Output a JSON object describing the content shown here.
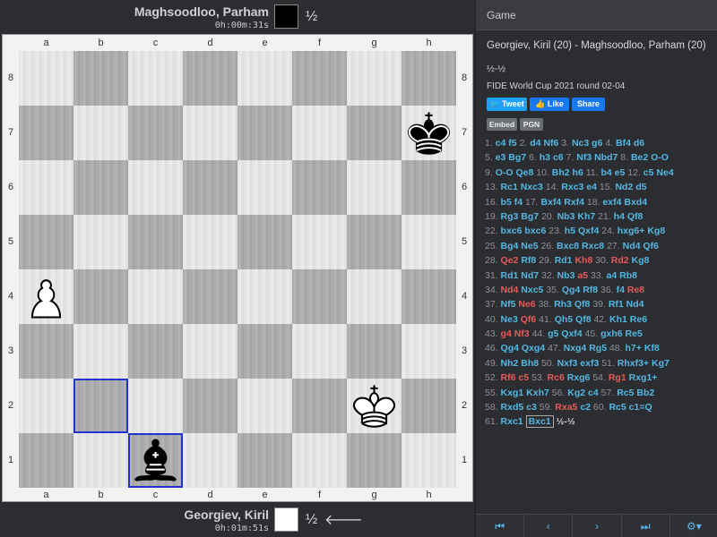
{
  "top_player": {
    "name": "Maghsoodloo, Parham",
    "clock": "0h:00m:31s",
    "result": "½"
  },
  "bottom_player": {
    "name": "Georgiev, Kiril",
    "clock": "0h:01m:51s",
    "result": "½",
    "to_move_arrow": "🡐"
  },
  "board": {
    "files": [
      "a",
      "b",
      "c",
      "d",
      "e",
      "f",
      "g",
      "h"
    ],
    "ranks": [
      "8",
      "7",
      "6",
      "5",
      "4",
      "3",
      "2",
      "1"
    ],
    "highlighted_squares": [
      "b2",
      "c1"
    ],
    "pieces": [
      {
        "square": "h7",
        "piece": "black-king"
      },
      {
        "square": "a4",
        "piece": "white-pawn"
      },
      {
        "square": "g2",
        "piece": "white-king"
      },
      {
        "square": "c1",
        "piece": "black-bishop"
      }
    ]
  },
  "panel": {
    "header": "Game",
    "title": "Georgiev, Kiril (20) - Maghsoodloo, Parham (20)",
    "result": "½-½",
    "event": "FIDE World Cup 2021 round 02-04",
    "tweet": "Tweet",
    "like": "Like",
    "share": "Share",
    "embed": "Embed",
    "pgn": "PGN"
  },
  "moves": [
    [
      [
        "n",
        "1."
      ],
      [
        "m",
        "c4"
      ],
      [
        "m",
        "f5"
      ],
      [
        "n",
        "2."
      ],
      [
        "m",
        "d4"
      ],
      [
        "m",
        "Nf6"
      ],
      [
        "n",
        "3."
      ],
      [
        "m",
        "Nc3"
      ],
      [
        "m",
        "g6"
      ],
      [
        "n",
        "4."
      ],
      [
        "m",
        "Bf4"
      ],
      [
        "m",
        "d6"
      ]
    ],
    [
      [
        "n",
        "5."
      ],
      [
        "m",
        "e3"
      ],
      [
        "m",
        "Bg7"
      ],
      [
        "n",
        "6."
      ],
      [
        "m",
        "h3"
      ],
      [
        "m",
        "c6"
      ],
      [
        "n",
        "7."
      ],
      [
        "m",
        "Nf3"
      ],
      [
        "m",
        "Nbd7"
      ],
      [
        "n",
        "8."
      ],
      [
        "m",
        "Be2"
      ],
      [
        "m",
        "O-O"
      ]
    ],
    [
      [
        "n",
        "9."
      ],
      [
        "m",
        "O-O"
      ],
      [
        "m",
        "Qe8"
      ],
      [
        "n",
        "10."
      ],
      [
        "m",
        "Bh2"
      ],
      [
        "m",
        "h6"
      ],
      [
        "n",
        "11."
      ],
      [
        "m",
        "b4"
      ],
      [
        "m",
        "e5"
      ],
      [
        "n",
        "12."
      ],
      [
        "m",
        "c5"
      ],
      [
        "m",
        "Ne4"
      ]
    ],
    [
      [
        "n",
        "13."
      ],
      [
        "m",
        "Rc1"
      ],
      [
        "m",
        "Nxc3"
      ],
      [
        "n",
        "14."
      ],
      [
        "m",
        "Rxc3"
      ],
      [
        "m",
        "e4"
      ],
      [
        "n",
        "15."
      ],
      [
        "m",
        "Nd2"
      ],
      [
        "m",
        "d5"
      ]
    ],
    [
      [
        "n",
        "16."
      ],
      [
        "m",
        "b5"
      ],
      [
        "m",
        "f4"
      ],
      [
        "n",
        "17."
      ],
      [
        "m",
        "Bxf4"
      ],
      [
        "m",
        "Rxf4"
      ],
      [
        "n",
        "18."
      ],
      [
        "m",
        "exf4"
      ],
      [
        "m",
        "Bxd4"
      ]
    ],
    [
      [
        "n",
        "19."
      ],
      [
        "m",
        "Rg3"
      ],
      [
        "m",
        "Bg7"
      ],
      [
        "n",
        "20."
      ],
      [
        "m",
        "Nb3"
      ],
      [
        "m",
        "Kh7"
      ],
      [
        "n",
        "21."
      ],
      [
        "m",
        "h4"
      ],
      [
        "m",
        "Qf8"
      ]
    ],
    [
      [
        "n",
        "22."
      ],
      [
        "m",
        "bxc6"
      ],
      [
        "m",
        "bxc6"
      ],
      [
        "n",
        "23."
      ],
      [
        "m",
        "h5"
      ],
      [
        "m",
        "Qxf4"
      ],
      [
        "n",
        "24."
      ],
      [
        "m",
        "hxg6+"
      ],
      [
        "m",
        "Kg8"
      ]
    ],
    [
      [
        "n",
        "25."
      ],
      [
        "m",
        "Bg4"
      ],
      [
        "m",
        "Ne5"
      ],
      [
        "n",
        "26."
      ],
      [
        "m",
        "Bxc8"
      ],
      [
        "m",
        "Rxc8"
      ],
      [
        "n",
        "27."
      ],
      [
        "m",
        "Nd4"
      ],
      [
        "m",
        "Qf6"
      ]
    ],
    [
      [
        "n",
        "28."
      ],
      [
        "b",
        "Qe2"
      ],
      [
        "m",
        "Rf8"
      ],
      [
        "n",
        "29."
      ],
      [
        "m",
        "Rd1"
      ],
      [
        "b",
        "Kh8"
      ],
      [
        "n",
        "30."
      ],
      [
        "b",
        "Rd2"
      ],
      [
        "m",
        "Kg8"
      ]
    ],
    [
      [
        "n",
        "31."
      ],
      [
        "m",
        "Rd1"
      ],
      [
        "m",
        "Nd7"
      ],
      [
        "n",
        "32."
      ],
      [
        "m",
        "Nb3"
      ],
      [
        "b",
        "a5"
      ],
      [
        "n",
        "33."
      ],
      [
        "m",
        "a4"
      ],
      [
        "m",
        "Rb8"
      ]
    ],
    [
      [
        "n",
        "34."
      ],
      [
        "b",
        "Nd4"
      ],
      [
        "m",
        "Nxc5"
      ],
      [
        "n",
        "35."
      ],
      [
        "m",
        "Qg4"
      ],
      [
        "m",
        "Rf8"
      ],
      [
        "n",
        "36."
      ],
      [
        "m",
        "f4"
      ],
      [
        "b",
        "Re8"
      ]
    ],
    [
      [
        "n",
        "37."
      ],
      [
        "m",
        "Nf5"
      ],
      [
        "b",
        "Ne6"
      ],
      [
        "n",
        "38."
      ],
      [
        "m",
        "Rh3"
      ],
      [
        "m",
        "Qf8"
      ],
      [
        "n",
        "39."
      ],
      [
        "m",
        "Rf1"
      ],
      [
        "m",
        "Nd4"
      ]
    ],
    [
      [
        "n",
        "40."
      ],
      [
        "m",
        "Ne3"
      ],
      [
        "b",
        "Qf6"
      ],
      [
        "n",
        "41."
      ],
      [
        "m",
        "Qh5"
      ],
      [
        "m",
        "Qf8"
      ],
      [
        "n",
        "42."
      ],
      [
        "m",
        "Kh1"
      ],
      [
        "m",
        "Re6"
      ]
    ],
    [
      [
        "n",
        "43."
      ],
      [
        "b",
        "g4"
      ],
      [
        "b",
        "Nf3"
      ],
      [
        "n",
        "44."
      ],
      [
        "m",
        "g5"
      ],
      [
        "m",
        "Qxf4"
      ],
      [
        "n",
        "45."
      ],
      [
        "m",
        "gxh6"
      ],
      [
        "m",
        "Re5"
      ]
    ],
    [
      [
        "n",
        "46."
      ],
      [
        "m",
        "Qg4"
      ],
      [
        "m",
        "Qxg4"
      ],
      [
        "n",
        "47."
      ],
      [
        "m",
        "Nxg4"
      ],
      [
        "m",
        "Rg5"
      ],
      [
        "n",
        "48."
      ],
      [
        "m",
        "h7+"
      ],
      [
        "m",
        "Kf8"
      ]
    ],
    [
      [
        "n",
        "49."
      ],
      [
        "m",
        "Nh2"
      ],
      [
        "m",
        "Bh8"
      ],
      [
        "n",
        "50."
      ],
      [
        "m",
        "Nxf3"
      ],
      [
        "m",
        "exf3"
      ],
      [
        "n",
        "51."
      ],
      [
        "m",
        "Rhxf3+"
      ],
      [
        "m",
        "Kg7"
      ]
    ],
    [
      [
        "n",
        "52."
      ],
      [
        "b",
        "Rf6"
      ],
      [
        "b",
        "c5"
      ],
      [
        "n",
        "53."
      ],
      [
        "b",
        "Rc6"
      ],
      [
        "m",
        "Rxg6"
      ],
      [
        "n",
        "54."
      ],
      [
        "b",
        "Rg1"
      ],
      [
        "m",
        "Rxg1+"
      ]
    ],
    [
      [
        "n",
        "55."
      ],
      [
        "m",
        "Kxg1"
      ],
      [
        "m",
        "Kxh7"
      ],
      [
        "n",
        "56."
      ],
      [
        "m",
        "Kg2"
      ],
      [
        "m",
        "c4"
      ],
      [
        "n",
        "57."
      ],
      [
        "m",
        "Rc5"
      ],
      [
        "m",
        "Bb2"
      ]
    ],
    [
      [
        "n",
        "58."
      ],
      [
        "m",
        "Rxd5"
      ],
      [
        "m",
        "c3"
      ],
      [
        "n",
        "59."
      ],
      [
        "b",
        "Rxa5"
      ],
      [
        "m",
        "c2"
      ],
      [
        "n",
        "60."
      ],
      [
        "m",
        "Rc5"
      ],
      [
        "m",
        "c1=Q"
      ]
    ],
    [
      [
        "n",
        "61."
      ],
      [
        "m",
        "Rxc1"
      ],
      [
        "c",
        "Bxc1"
      ],
      [
        "r",
        "½-½"
      ]
    ]
  ],
  "nav": [
    {
      "name": "first-move-button",
      "glyph": "⏮"
    },
    {
      "name": "prev-move-button",
      "glyph": "‹"
    },
    {
      "name": "next-move-button",
      "glyph": "›"
    },
    {
      "name": "last-move-button",
      "glyph": "⏭"
    },
    {
      "name": "settings-button",
      "glyph": "⚙▾"
    }
  ]
}
